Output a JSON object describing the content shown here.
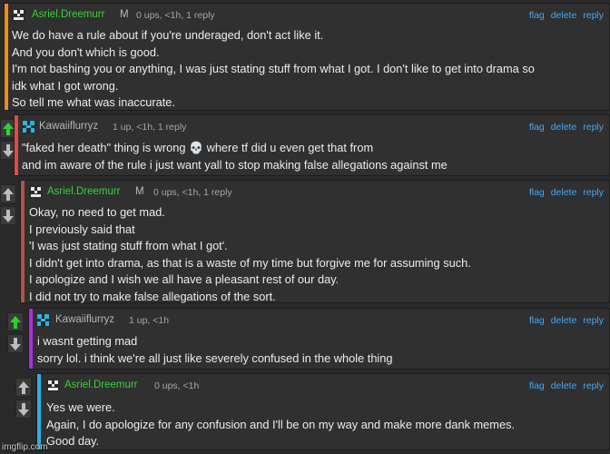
{
  "colors": {
    "accent_c1": "#f08c1a",
    "accent_c2": "#e24a4a",
    "accent_c3": "#b0524a",
    "accent_c4": "#b02ce0",
    "accent_c5": "#2fb1e8",
    "username_asriel": "#34d234",
    "username_kawaii": "#b5b5b5",
    "link": "#41a9f5",
    "upvote_active": "#2fd02f",
    "vote_inactive": "#bdbdbd"
  },
  "comments": [
    {
      "username": "Asriel.Dreemurr",
      "mod_badge": "M",
      "meta": "0 ups, <1h, 1 reply",
      "actions": [
        "flag",
        "delete",
        "reply"
      ],
      "lines": [
        "We do have a rule about if you're underaged, don't act like it.",
        "And you don't which is good.",
        "I'm not bashing you or anything, I was just stating stuff from what I got. I don't like to get into drama so",
        "idk what I got wrong.",
        "So tell me what was inaccurate."
      ]
    },
    {
      "username": "Kawaiiflurryz",
      "meta": "1 up, <1h, 1 reply",
      "actions": [
        "flag",
        "delete",
        "reply"
      ],
      "lines": [
        "\"faked her death\" thing is wrong 💀 where tf did u even get that from",
        "and im aware of the rule i just want yall to stop making false allegations against me"
      ]
    },
    {
      "username": "Asriel.Dreemurr",
      "mod_badge": "M",
      "meta": "0 ups, <1h, 1 reply",
      "actions": [
        "flag",
        "delete",
        "reply"
      ],
      "lines": [
        "Okay, no need to get mad.",
        "I previously said that",
        "'I was just stating stuff from what I got'.",
        "I didn't get into drama, as that is a waste of my time but forgive me for assuming such.",
        "I apologize and I wish we all have a pleasant rest of our day.",
        "I did not try to make false allegations of the sort."
      ]
    },
    {
      "username": "Kawaiiflurryz",
      "meta": "1 up, <1h",
      "actions": [
        "flag",
        "delete",
        "reply"
      ],
      "lines": [
        "i wasnt getting mad",
        "sorry lol. i think we're all just like severely confused in the whole thing"
      ]
    },
    {
      "username": "Asriel.Dreemurr",
      "meta": "0 ups, <1h",
      "actions": [
        "flag",
        "delete",
        "reply"
      ],
      "lines": [
        "Yes we were.",
        "Again, I do apologize for any confusion and I'll be on my way and make more dank memes.",
        "Good day."
      ]
    }
  ],
  "watermark": "imgflip.com"
}
